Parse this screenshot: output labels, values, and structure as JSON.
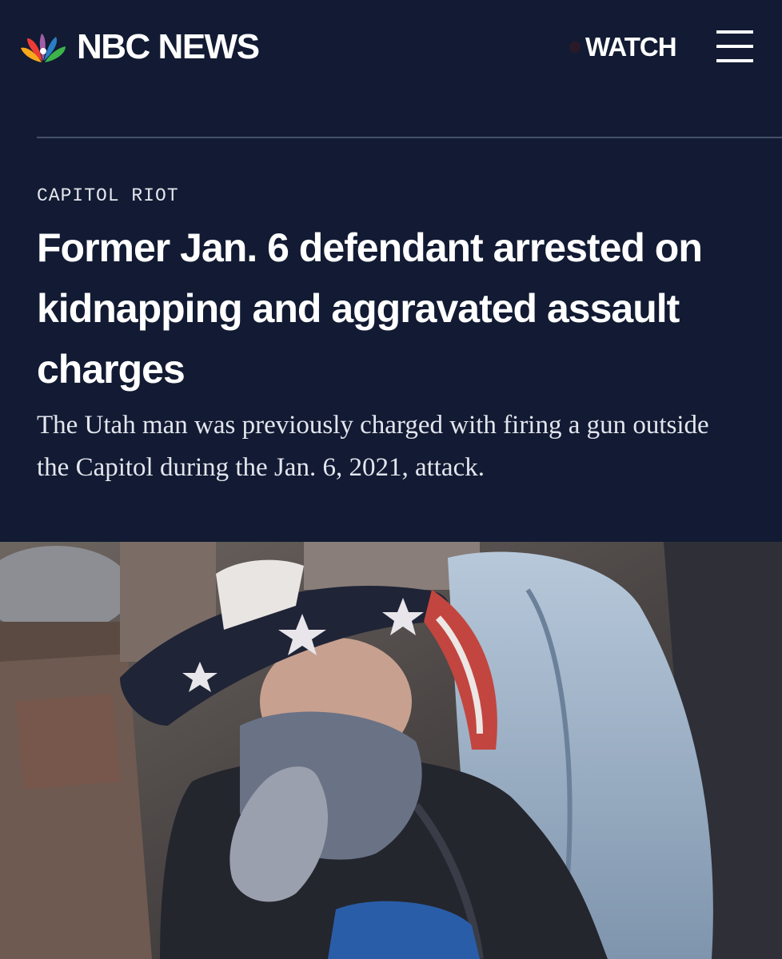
{
  "header": {
    "brand": "NBC NEWS",
    "logo_icon": "nbc-peacock-icon",
    "watch_label": "WATCH",
    "menu_icon": "hamburger-menu-icon"
  },
  "article": {
    "category": "CAPITOL RIOT",
    "headline": "Former Jan. 6 defendant arrested on kidnapping and aggravated assault charges",
    "dek": "The Utah man was previously charged with firing a gun outside the Capitol during the Jan. 6, 2021, attack."
  },
  "colors": {
    "background": "#121b33",
    "text": "#ffffff",
    "divider": "#46506a"
  }
}
